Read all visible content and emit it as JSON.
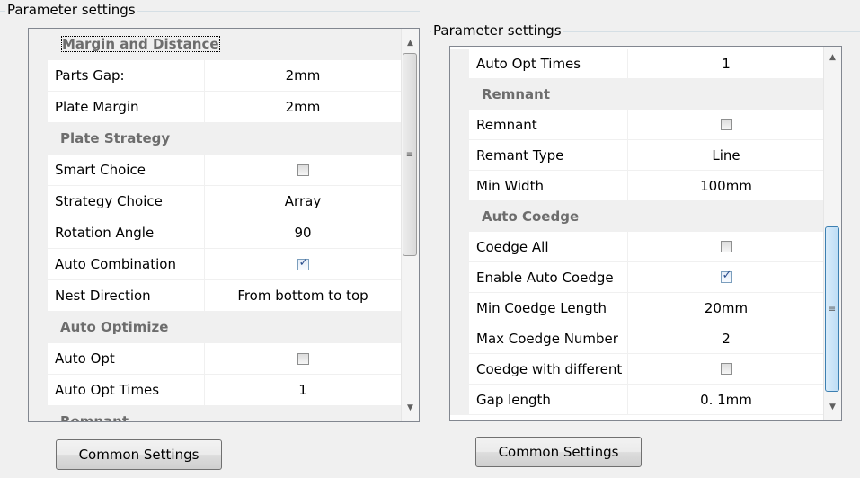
{
  "left_panel": {
    "title": "Parameter settings",
    "rows": [
      {
        "type": "category",
        "name": "Margin and Distance",
        "focused": true
      },
      {
        "type": "text",
        "name": "Parts Gap:",
        "value": "2mm"
      },
      {
        "type": "text",
        "name": "Plate Margin",
        "value": "2mm"
      },
      {
        "type": "category",
        "name": "Plate Strategy"
      },
      {
        "type": "check",
        "name": "Smart Choice",
        "checked": false
      },
      {
        "type": "text",
        "name": "Strategy Choice",
        "value": "Array"
      },
      {
        "type": "text",
        "name": "Rotation Angle",
        "value": "90"
      },
      {
        "type": "check",
        "name": "Auto Combination",
        "checked": true
      },
      {
        "type": "text",
        "name": "Nest Direction",
        "value": "From bottom to top"
      },
      {
        "type": "category",
        "name": "Auto Optimize"
      },
      {
        "type": "check",
        "name": "Auto Opt",
        "checked": false
      },
      {
        "type": "text",
        "name": "Auto Opt Times",
        "value": "1"
      },
      {
        "type": "category",
        "name": "Remnant"
      }
    ],
    "button": "Common Settings"
  },
  "right_panel": {
    "title": "Parameter settings",
    "rows": [
      {
        "type": "text",
        "name": "Auto Opt Times",
        "value": "1"
      },
      {
        "type": "category",
        "name": "Remnant"
      },
      {
        "type": "check",
        "name": "Remnant",
        "checked": false
      },
      {
        "type": "text",
        "name": "Remant Type",
        "value": "Line"
      },
      {
        "type": "text",
        "name": "Min Width",
        "value": "100mm"
      },
      {
        "type": "category",
        "name": "Auto Coedge"
      },
      {
        "type": "check",
        "name": "Coedge All",
        "checked": false
      },
      {
        "type": "check",
        "name": "Enable Auto Coedge",
        "checked": true
      },
      {
        "type": "text",
        "name": "Min Coedge Length",
        "value": "20mm"
      },
      {
        "type": "text",
        "name": "Max Coedge Number",
        "value": "2"
      },
      {
        "type": "check",
        "name": "Coedge with different",
        "checked": false
      },
      {
        "type": "text",
        "name": "Gap length",
        "value": "0. 1mm"
      }
    ],
    "button": "Common Settings"
  },
  "icons": {
    "scroll_up": "triangle-up-icon",
    "scroll_down": "triangle-down-icon",
    "grip": "grip-lines-icon",
    "check": "checkmark-icon"
  }
}
